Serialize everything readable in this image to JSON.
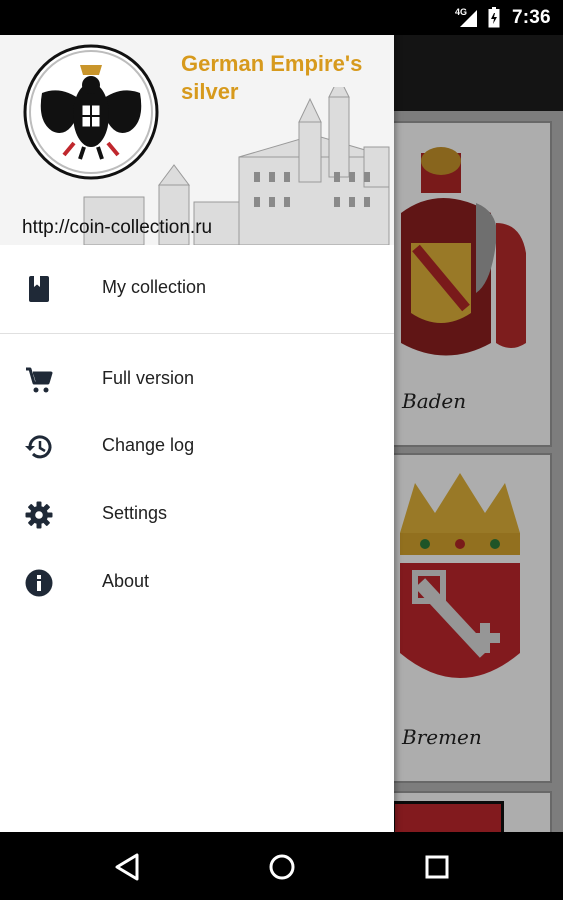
{
  "status_bar": {
    "network": "4G",
    "time": "7:36"
  },
  "drawer": {
    "header": {
      "title": "German Empire's silver",
      "url": "http://coin-collection.ru"
    },
    "items": [
      {
        "label": "My collection",
        "icon": "book-icon"
      },
      {
        "label": "Full version",
        "icon": "cart-icon"
      },
      {
        "label": "Change log",
        "icon": "history-icon"
      },
      {
        "label": "Settings",
        "icon": "gear-icon"
      },
      {
        "label": "About",
        "icon": "info-icon"
      }
    ]
  },
  "background": {
    "cards": [
      {
        "label": "Baden"
      },
      {
        "label": "Bremen"
      }
    ]
  },
  "colors": {
    "title": "#d79a1d",
    "icon": "#1f2937"
  }
}
